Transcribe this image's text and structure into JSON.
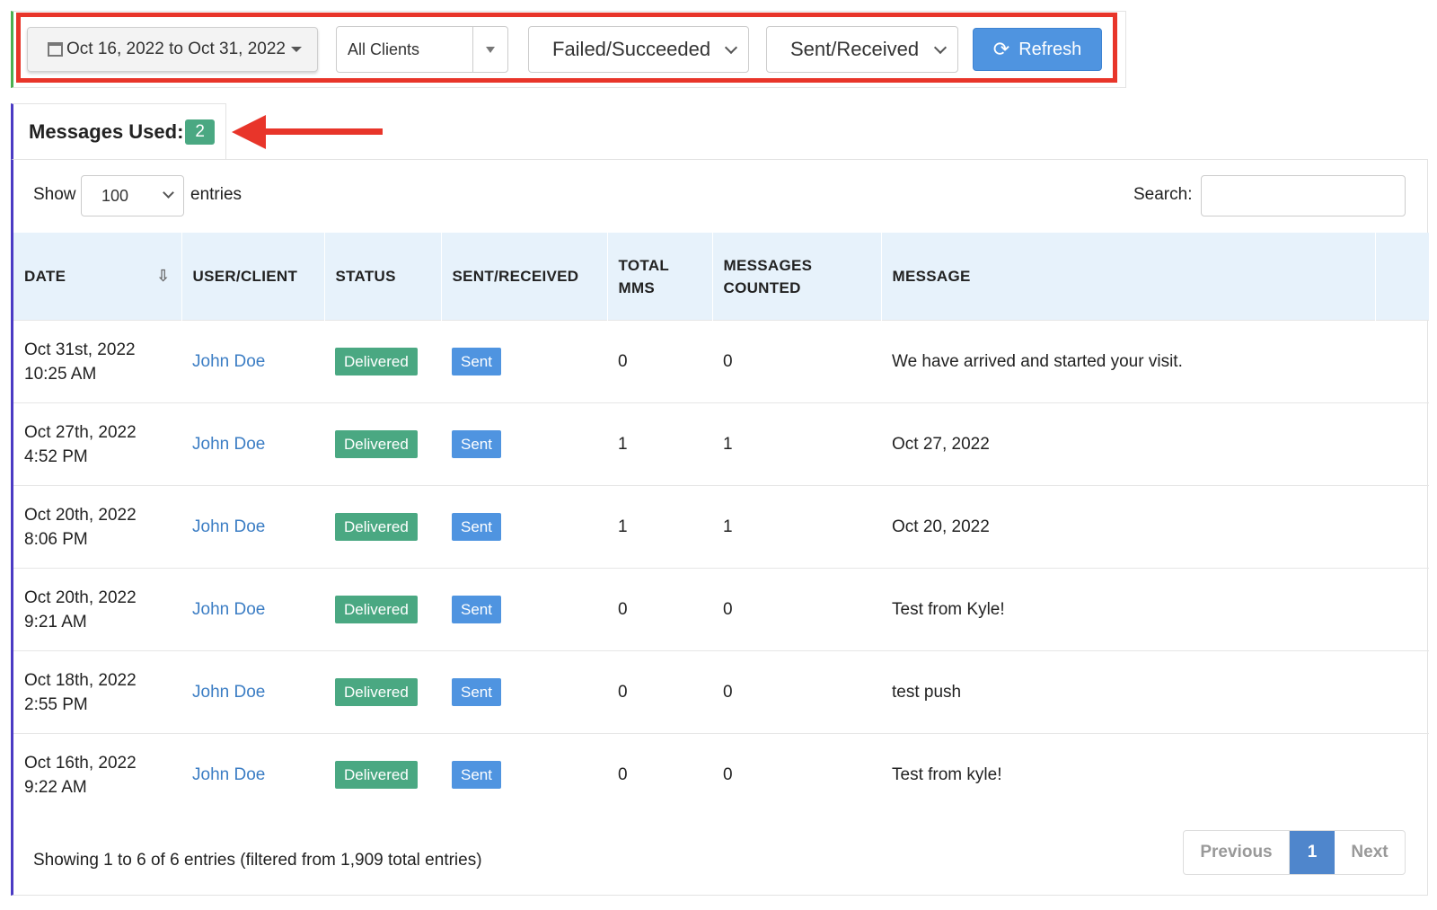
{
  "filters": {
    "date_range": "Oct 16, 2022 to Oct 31, 2022",
    "clients": "All Clients",
    "status": "Failed/Succeeded",
    "direction": "Sent/Received",
    "refresh_label": "Refresh"
  },
  "messages_used": {
    "label": "Messages Used:",
    "count": "2"
  },
  "table_controls": {
    "show_label": "Show",
    "page_size": "100",
    "entries_label": "entries",
    "search_label": "Search:",
    "search_value": ""
  },
  "columns": {
    "date": "DATE",
    "user": "USER/CLIENT",
    "status": "STATUS",
    "direction": "SENT/RECEIVED",
    "mms_1": "TOTAL",
    "mms_2": "MMS",
    "counted_1": "MESSAGES",
    "counted_2": "COUNTED",
    "message": "MESSAGE"
  },
  "rows": [
    {
      "date": "Oct 31st, 2022",
      "time": "10:25 AM",
      "user": "John Doe",
      "status": "Delivered",
      "direction": "Sent",
      "mms": "0",
      "counted": "0",
      "message": "We have arrived and started your visit."
    },
    {
      "date": "Oct 27th, 2022",
      "time": "4:52 PM",
      "user": "John Doe",
      "status": "Delivered",
      "direction": "Sent",
      "mms": "1",
      "counted": "1",
      "message": "Oct 27, 2022"
    },
    {
      "date": "Oct 20th, 2022",
      "time": "8:06 PM",
      "user": "John Doe",
      "status": "Delivered",
      "direction": "Sent",
      "mms": "1",
      "counted": "1",
      "message": "Oct 20, 2022"
    },
    {
      "date": "Oct 20th, 2022",
      "time": "9:21 AM",
      "user": "John Doe",
      "status": "Delivered",
      "direction": "Sent",
      "mms": "0",
      "counted": "0",
      "message": "Test from Kyle!"
    },
    {
      "date": "Oct 18th, 2022",
      "time": "2:55 PM",
      "user": "John Doe",
      "status": "Delivered",
      "direction": "Sent",
      "mms": "0",
      "counted": "0",
      "message": "test push"
    },
    {
      "date": "Oct 16th, 2022",
      "time": "9:22 AM",
      "user": "John Doe",
      "status": "Delivered",
      "direction": "Sent",
      "mms": "0",
      "counted": "0",
      "message": "Test from kyle!"
    }
  ],
  "footer": {
    "info": "Showing 1 to 6 of 6 entries (filtered from 1,909 total entries)",
    "previous": "Previous",
    "current_page": "1",
    "next": "Next"
  },
  "colors": {
    "annotation_red": "#e8352a",
    "badge_green": "#4aa882",
    "badge_blue": "#4f94e0",
    "header_bg": "#e7f2fb",
    "link": "#3b7dc4"
  }
}
